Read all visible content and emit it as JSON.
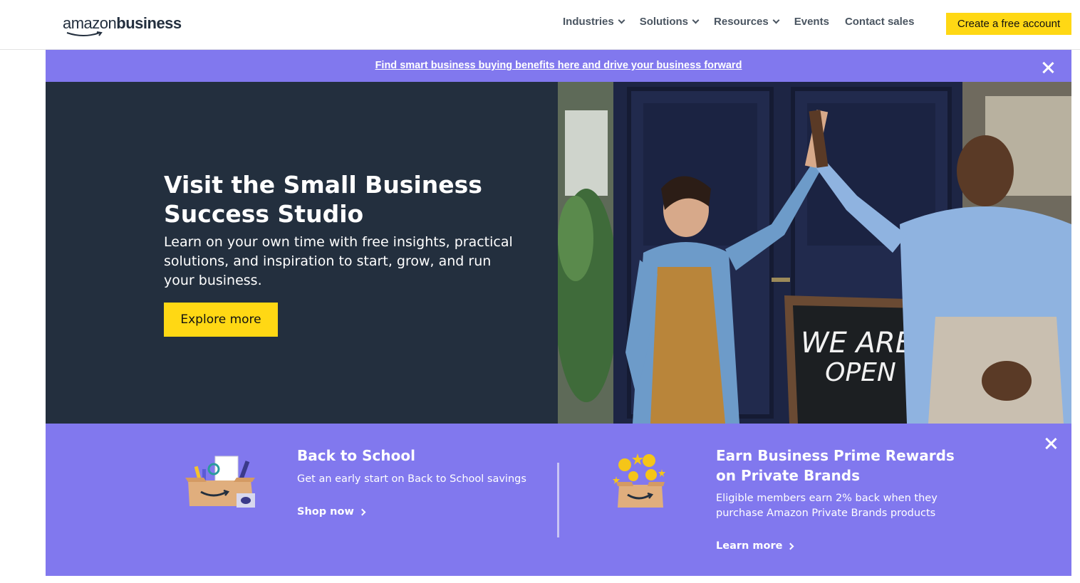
{
  "brand": {
    "logo_word_1": "amazon",
    "logo_word_2": "business"
  },
  "nav": {
    "items": [
      {
        "label": "Industries",
        "dropdown": true
      },
      {
        "label": "Solutions",
        "dropdown": true
      },
      {
        "label": "Resources",
        "dropdown": true
      },
      {
        "label": "Events",
        "dropdown": false
      },
      {
        "label": "Contact sales",
        "dropdown": false
      }
    ],
    "cta_label": "Create a free account"
  },
  "announcement": {
    "link_text": "Find smart business buying benefits here and drive your business forward"
  },
  "hero": {
    "title": "Visit the Small Business Success Studio",
    "description": "Learn on your own time with free insights, practical solutions, and inspiration to start, grow, and run your business.",
    "button_label": "Explore more",
    "sign_text_1": "WE ARE",
    "sign_text_2": "OPEN"
  },
  "promos": [
    {
      "title": "Back to School",
      "description": "Get an early start on Back to School savings",
      "link_label": "Shop now",
      "icon": "school-supplies-box-icon"
    },
    {
      "title": "Earn Business Prime Rewards on Private Brands",
      "description": "Eligible members earn 2% back when they purchase Amazon Private Brands products",
      "link_label": "Learn more",
      "icon": "rewards-box-icon"
    }
  ],
  "colors": {
    "accent_purple": "#8178ee",
    "hero_dark": "#232f3e",
    "cta_yellow": "#ffd814"
  }
}
